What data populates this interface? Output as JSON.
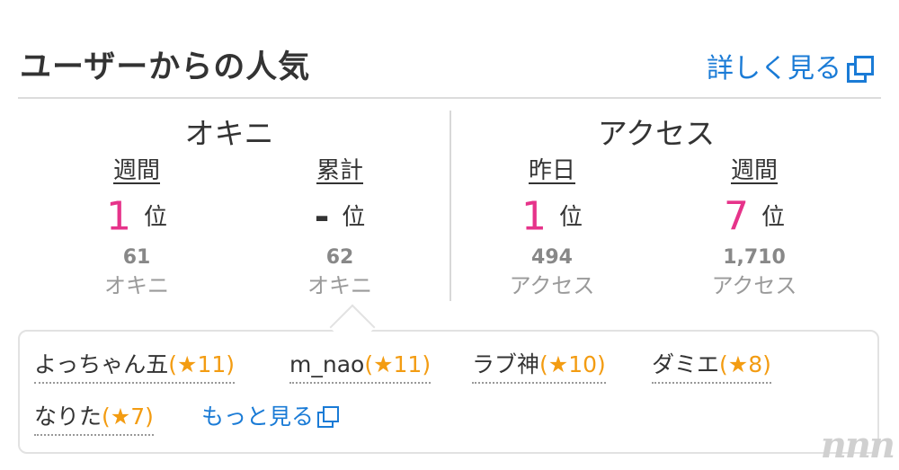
{
  "header": {
    "title": "ユーザーからの人気",
    "more_link": "詳しく見る"
  },
  "okini": {
    "heading": "オキニ",
    "weekly": {
      "period": "週間",
      "rank": "1",
      "unit": "位",
      "count": "61",
      "sub": "オキニ"
    },
    "total": {
      "period": "累計",
      "rank": "-",
      "unit": "位",
      "count": "62",
      "sub": "オキニ"
    }
  },
  "access": {
    "heading": "アクセス",
    "yesterday": {
      "period": "昨日",
      "rank": "1",
      "unit": "位",
      "count": "494",
      "sub": "アクセス"
    },
    "weekly": {
      "period": "週間",
      "rank": "7",
      "unit": "位",
      "count": "1,710",
      "sub": "アクセス"
    }
  },
  "fans": {
    "items": [
      {
        "name": "よっちゃん五",
        "open": "(",
        "star": "★",
        "count": "11",
        "close": ")"
      },
      {
        "name": "m_nao",
        "open": "(",
        "star": "★",
        "count": "11",
        "close": ")"
      },
      {
        "name": "ラブ神",
        "open": "(",
        "star": "★",
        "count": "10",
        "close": ")"
      },
      {
        "name": "ダミエ",
        "open": "(",
        "star": "★",
        "count": "8",
        "close": ")"
      },
      {
        "name": "なりた",
        "open": "(",
        "star": "★",
        "count": "7",
        "close": ")"
      }
    ],
    "more_label": "もっと見る"
  },
  "watermark": "nnn",
  "colors": {
    "rank_pink": "#e6338a",
    "link_blue": "#1a7bd6",
    "star_orange": "#f39c12"
  }
}
